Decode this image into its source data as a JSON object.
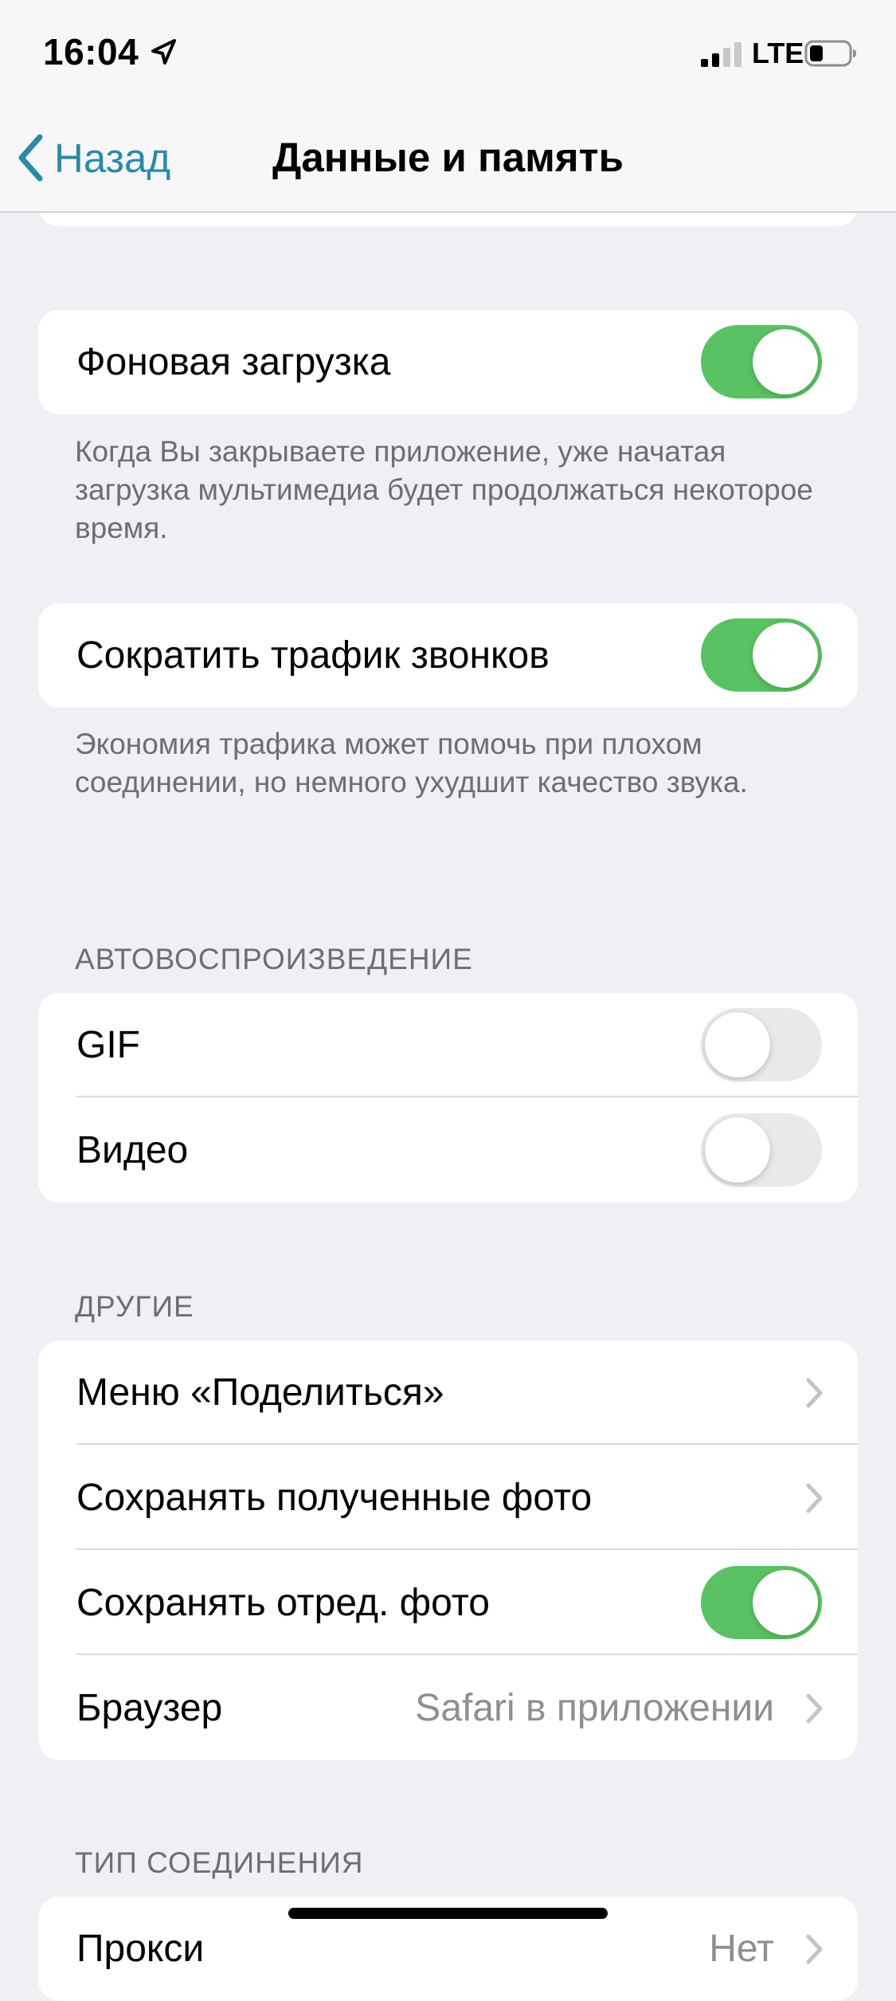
{
  "status_bar": {
    "time": "16:04",
    "network": "LTE",
    "icons": [
      "location-arrow-icon",
      "signal-icon",
      "battery-icon"
    ]
  },
  "nav": {
    "back_label": "Назад",
    "title": "Данные и память",
    "accent": "#2b8aa6"
  },
  "background_download": {
    "label": "Фоновая загрузка",
    "enabled": true,
    "footer": "Когда Вы закрываете приложение, уже начатая загрузка мультимедиа будет продолжаться некоторое время."
  },
  "reduce_call_traffic": {
    "label": "Сократить трафик звонков",
    "enabled": true,
    "footer": "Экономия трафика может помочь при плохом соединении, но немного ухудшит качество звука."
  },
  "autoplay": {
    "header": "АВТОВОСПРОИЗВЕДЕНИЕ",
    "items": [
      {
        "label": "GIF",
        "enabled": false
      },
      {
        "label": "Видео",
        "enabled": false
      }
    ]
  },
  "other": {
    "header": "ДРУГИЕ",
    "items": [
      {
        "label": "Меню «Поделиться»"
      },
      {
        "label": "Сохранять полученные фото"
      },
      {
        "label": "Сохранять отред. фото",
        "enabled": true
      },
      {
        "label": "Браузер",
        "value": "Safari в приложении"
      }
    ]
  },
  "connection_type": {
    "header": "ТИП СОЕДИНЕНИЯ",
    "items": [
      {
        "label": "Прокси",
        "value": "Нет"
      }
    ]
  },
  "colors": {
    "toggle_on": "#5ac263",
    "toggle_off": "#e9e9eb",
    "background": "#efeff4"
  }
}
